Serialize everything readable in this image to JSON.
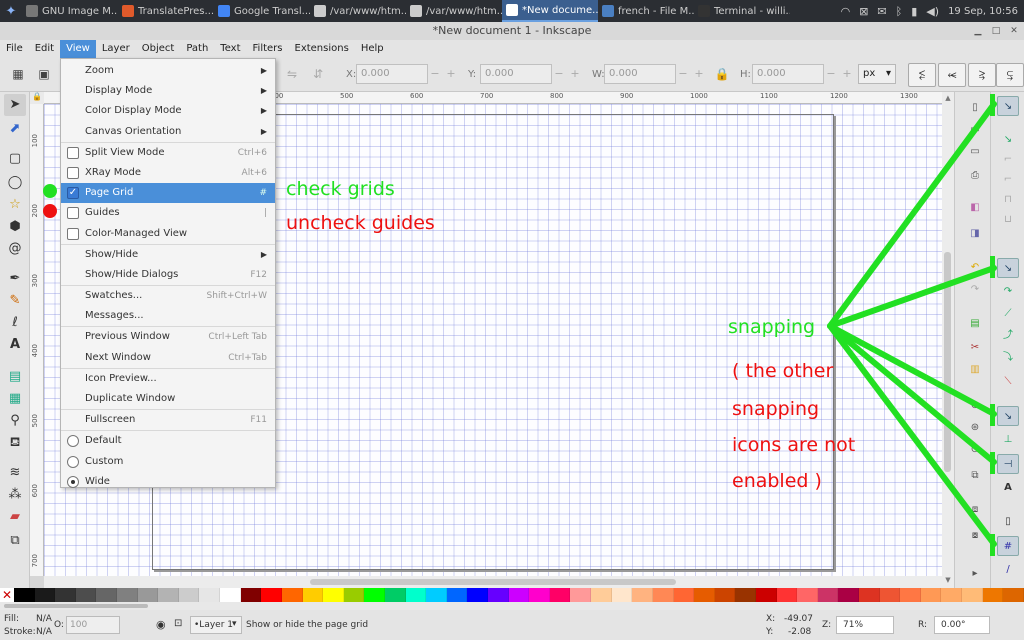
{
  "taskbar": {
    "tasks": [
      "GNU Image M...",
      "TranslatePres...",
      "Google Transl...",
      "/var/www/htm...",
      "/var/www/htm...",
      "*New docume...",
      "french - File M...",
      "Terminal - willi..."
    ],
    "task_colors": [
      "#777777",
      "#e05a2b",
      "#4285f4",
      "#cccccc",
      "#cccccc",
      "#ffffff",
      "#4a7fc1",
      "#333333"
    ],
    "active_index": 5,
    "clock": "19 Sep, 10:56"
  },
  "window": {
    "title": "*New document 1 - Inkscape"
  },
  "menubar": [
    "File",
    "Edit",
    "View",
    "Layer",
    "Object",
    "Path",
    "Text",
    "Filters",
    "Extensions",
    "Help"
  ],
  "menubar_open": "View",
  "toolbar": {
    "x_label": "X:",
    "x_value": "0.000",
    "y_label": "Y:",
    "y_value": "0.000",
    "w_label": "W:",
    "w_value": "0.000",
    "h_label": "H:",
    "h_value": "0.000",
    "unit": "px"
  },
  "ruler": {
    "labels": [
      "100",
      "200",
      "300",
      "400",
      "500",
      "600",
      "700",
      "800",
      "900",
      "1000",
      "1100",
      "1200",
      "1300"
    ]
  },
  "view_menu": [
    {
      "type": "submenu",
      "label": "Zoom"
    },
    {
      "type": "submenu",
      "label": "Display Mode"
    },
    {
      "type": "submenu",
      "label": "Color Display Mode"
    },
    {
      "type": "submenu",
      "label": "Canvas Orientation"
    },
    {
      "type": "sep"
    },
    {
      "type": "check",
      "label": "Split View Mode",
      "accel": "Ctrl+6",
      "checked": false
    },
    {
      "type": "check",
      "label": "XRay Mode",
      "accel": "Alt+6",
      "checked": false
    },
    {
      "type": "check",
      "label": "Page Grid",
      "accel": "#",
      "checked": true,
      "highlight": true
    },
    {
      "type": "check",
      "label": "Guides",
      "accel": "|",
      "checked": false
    },
    {
      "type": "check",
      "label": "Color-Managed View",
      "accel": "",
      "checked": false
    },
    {
      "type": "sep"
    },
    {
      "type": "submenu",
      "label": "Show/Hide"
    },
    {
      "type": "item",
      "label": "Show/Hide Dialogs",
      "accel": "F12"
    },
    {
      "type": "sep"
    },
    {
      "type": "item",
      "label": "Swatches...",
      "accel": "Shift+Ctrl+W"
    },
    {
      "type": "item",
      "label": "Messages...",
      "accel": ""
    },
    {
      "type": "sep"
    },
    {
      "type": "item",
      "label": "Previous Window",
      "accel": "Ctrl+Left Tab"
    },
    {
      "type": "item",
      "label": "Next Window",
      "accel": "Ctrl+Tab"
    },
    {
      "type": "sep"
    },
    {
      "type": "item",
      "label": "Icon Preview...",
      "accel": ""
    },
    {
      "type": "item",
      "label": "Duplicate Window",
      "accel": ""
    },
    {
      "type": "sep"
    },
    {
      "type": "item",
      "label": "Fullscreen",
      "accel": "F11"
    },
    {
      "type": "sep"
    },
    {
      "type": "radio",
      "label": "Default",
      "checked": false
    },
    {
      "type": "radio",
      "label": "Custom",
      "checked": false
    },
    {
      "type": "radio",
      "label": "Wide",
      "checked": true
    }
  ],
  "annotations": {
    "check_grids": "check grids",
    "uncheck_guides": "uncheck guides",
    "snapping": "snapping",
    "note_lines": [
      "( the other",
      "snapping",
      "icons are not",
      "enabled )"
    ],
    "green": "#22e022",
    "red": "#ee1111"
  },
  "palette": [
    "#000000",
    "#1a1a1a",
    "#333333",
    "#4d4d4d",
    "#666666",
    "#808080",
    "#999999",
    "#b3b3b3",
    "#cccccc",
    "#e6e6e6",
    "#ffffff",
    "#800000",
    "#ff0000",
    "#ff6600",
    "#ffcc00",
    "#ffff00",
    "#99cc00",
    "#00ff00",
    "#00cc66",
    "#00ffcc",
    "#00ccff",
    "#0066ff",
    "#0000ff",
    "#6600ff",
    "#cc00ff",
    "#ff00cc",
    "#ff0066",
    "#ff9999",
    "#ffcc99",
    "#ffe6cc",
    "#ffb380",
    "#ff8855",
    "#ff6633",
    "#e65c00",
    "#cc4400",
    "#993300",
    "#cc0000",
    "#ff3333",
    "#ff6666",
    "#cc3366",
    "#aa0044",
    "#dd3322",
    "#ee5533",
    "#ff7744",
    "#ff9955",
    "#ffaa66",
    "#ffbb77",
    "#ee7700",
    "#dd6600"
  ],
  "statusbar": {
    "fill_label": "Fill:",
    "fill_value": "N/A",
    "stroke_label": "Stroke:",
    "stroke_value": "N/A",
    "opacity_label": "O:",
    "opacity_value": "100",
    "layer": "•Layer 1",
    "message": "Show or hide the page grid",
    "x_label": "X:",
    "x_value": "-49.07",
    "y_label": "Y:",
    "y_value": "-2.08",
    "zoom_label": "Z:",
    "zoom_value": "71%",
    "rotate_label": "R:",
    "rotate_value": "0.00°"
  }
}
